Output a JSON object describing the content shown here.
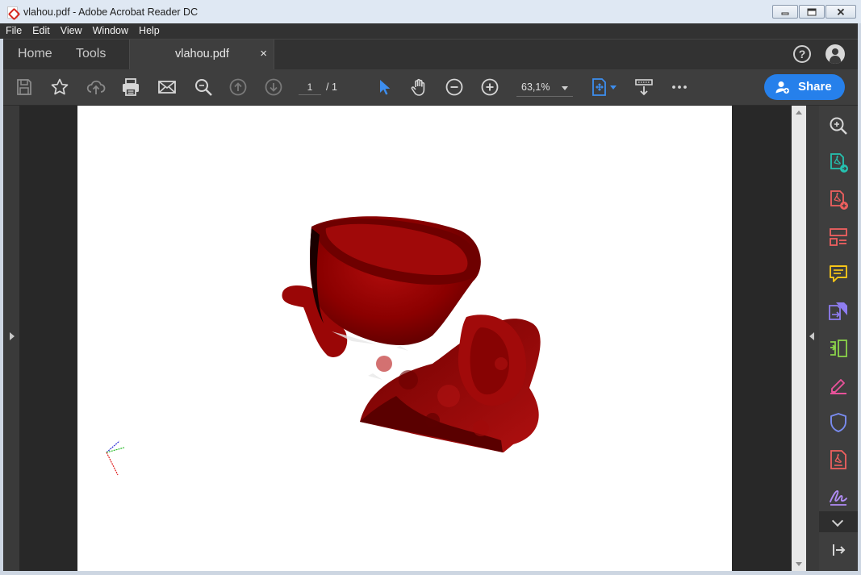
{
  "window": {
    "title": "vlahou.pdf - Adobe Acrobat Reader DC",
    "buttons": [
      "minimize",
      "maximize",
      "close"
    ]
  },
  "menu": [
    "File",
    "Edit",
    "View",
    "Window",
    "Help"
  ],
  "tabs": {
    "home": "Home",
    "tools": "Tools",
    "document": "vlahou.pdf",
    "close": "×"
  },
  "header_icons": {
    "help": "?",
    "account": "user-icon"
  },
  "toolbar": {
    "icons": [
      "save-icon",
      "star-icon",
      "upload-icon",
      "print-icon",
      "email-icon",
      "search-icon",
      "prev-page-icon",
      "next-page-icon",
      "select-tool-icon",
      "hand-tool-icon",
      "zoom-out-icon",
      "zoom-in-icon",
      "fit-page-icon",
      "scroll-mode-icon",
      "more-icon"
    ],
    "page_current": "1",
    "page_total": "/ 1",
    "zoom": "63,1%",
    "share_label": "Share"
  },
  "colors": {
    "model": "#8b0000",
    "accent": "#2680eb",
    "toolbar_bg": "#3e3e3e"
  },
  "tools_pane": {
    "icons": [
      "zoom-icon",
      "export-pdf-icon",
      "create-pdf-icon",
      "organize-pages-icon",
      "comment-icon",
      "combine-files-icon",
      "scan-icon",
      "fill-sign-icon",
      "protect-icon",
      "convert-pdf-icon",
      "sign-icon",
      "more-tools-icon",
      "collapse-pane-icon"
    ]
  },
  "document_content": {
    "type": "3D model render",
    "description_color": "dark red"
  }
}
